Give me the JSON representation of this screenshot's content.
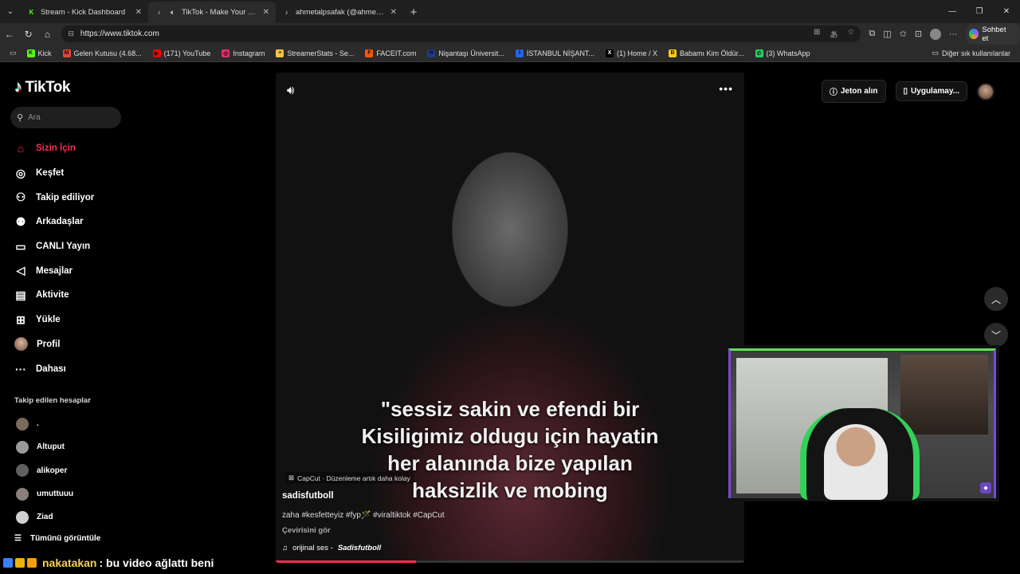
{
  "tabs": [
    {
      "label": "Stream - Kick Dashboard",
      "icon": "K",
      "color": "#53fc18",
      "active": false
    },
    {
      "label": "TikTok - Make Your Day",
      "icon": "♪",
      "color": "#ffffff",
      "active": true
    },
    {
      "label": "ahmetalpsafak (@ahmetalpsafak) | ...",
      "icon": "♪",
      "color": "#ffffff",
      "active": false
    }
  ],
  "address": {
    "url": "https://www.tiktok.com",
    "copilot_label": "Sohbet et"
  },
  "bookmarks": [
    {
      "label": "Kick",
      "icon": "K",
      "color": "#53fc18"
    },
    {
      "label": "Gelen Kutusu (4.68...",
      "icon": "M",
      "color": "#ea4335"
    },
    {
      "label": "(171) YouTube",
      "icon": "▶",
      "color": "#ff0000"
    },
    {
      "label": "Instagram",
      "icon": "◎",
      "color": "#e1306c"
    },
    {
      "label": "StreamerStats - Se...",
      "icon": "≡",
      "color": "#f5c542"
    },
    {
      "label": "FACEIT.com",
      "icon": "F",
      "color": "#ff5500"
    },
    {
      "label": "Nişantaşı Üniversit...",
      "icon": "N",
      "color": "#1e3a8a"
    },
    {
      "label": "İSTANBUL NİŞANT...",
      "icon": "İ",
      "color": "#2563eb"
    },
    {
      "label": "(1) Home / X",
      "icon": "X",
      "color": "#000000"
    },
    {
      "label": "Babamı Kim Öldür...",
      "icon": "B",
      "color": "#facc15"
    },
    {
      "label": "(3) WhatsApp",
      "icon": "✆",
      "color": "#25d366"
    }
  ],
  "bookmarks_other": "Diğer sık kullanılanlar",
  "tiktok": {
    "logo": "TikTok",
    "search_placeholder": "Ara",
    "nav": [
      {
        "label": "Sizin İçin",
        "icon": "⌂",
        "active": true
      },
      {
        "label": "Keşfet",
        "icon": "◎"
      },
      {
        "label": "Takip ediliyor",
        "icon": "⚇"
      },
      {
        "label": "Arkadaşlar",
        "icon": "⚉"
      },
      {
        "label": "CANLI Yayın",
        "icon": "▭"
      },
      {
        "label": "Mesajlar",
        "icon": "◁"
      },
      {
        "label": "Aktivite",
        "icon": "▤"
      },
      {
        "label": "Yükle",
        "icon": "⊞"
      },
      {
        "label": "Profil",
        "icon": "avatar"
      },
      {
        "label": "Dahası",
        "icon": "···"
      }
    ],
    "following_title": "Takip edilen hesaplar",
    "following": [
      ".",
      "Altuput",
      "alikoper",
      "umuttuuu",
      "Ziad"
    ],
    "see_all": "Tümünü görüntüle",
    "top_actions": {
      "coins": "Jeton alın",
      "app": "Uygulamay..."
    },
    "video": {
      "subtitle_lines": [
        "\"sessiz sakin ve efendi bir",
        "Kisiligimiz oldugu için hayatin",
        "her alanında bize yapılan",
        "haksizlik ve mobing"
      ],
      "capcut": "CapCut · Düzenleme artık daha kolay",
      "author": "sadisfutboll",
      "description": "zaha #kesfetteyiz #fyp🪄 #viraltiktok #CapCut",
      "translate": "Çevirisini gör",
      "music_prefix": "orijinal ses -",
      "music_author": "Sadisfutboll",
      "progress": 0.3
    }
  },
  "chat": {
    "username": "nakatakan",
    "message": ": bu video ağlattı beni"
  }
}
